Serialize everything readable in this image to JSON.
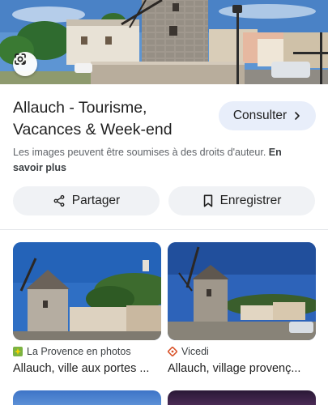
{
  "result": {
    "title": "Allauch - Tourisme, Vacances & Week-end",
    "consult_label": "Consulter",
    "copyright_text": "Les images peuvent être soumises à des droits d'auteur.",
    "learn_more_label": "En savoir plus",
    "share_label": "Partager",
    "save_label": "Enregistrer"
  },
  "related": [
    {
      "source": "La Provence en photos",
      "title": "Allauch, ville aux portes ...",
      "source_icon": "la-provence-favicon"
    },
    {
      "source": "Vicedi",
      "title": "Allauch, village provenç...",
      "source_icon": "vicedi-favicon"
    }
  ],
  "icons": {
    "lens": "google-lens-icon",
    "consult": "chevron-right-icon",
    "share": "share-icon",
    "save": "bookmark-icon"
  },
  "colors": {
    "consult_bg": "#e8eefa",
    "pill_bg": "#f0f2f5",
    "text_secondary": "#5f6368"
  }
}
